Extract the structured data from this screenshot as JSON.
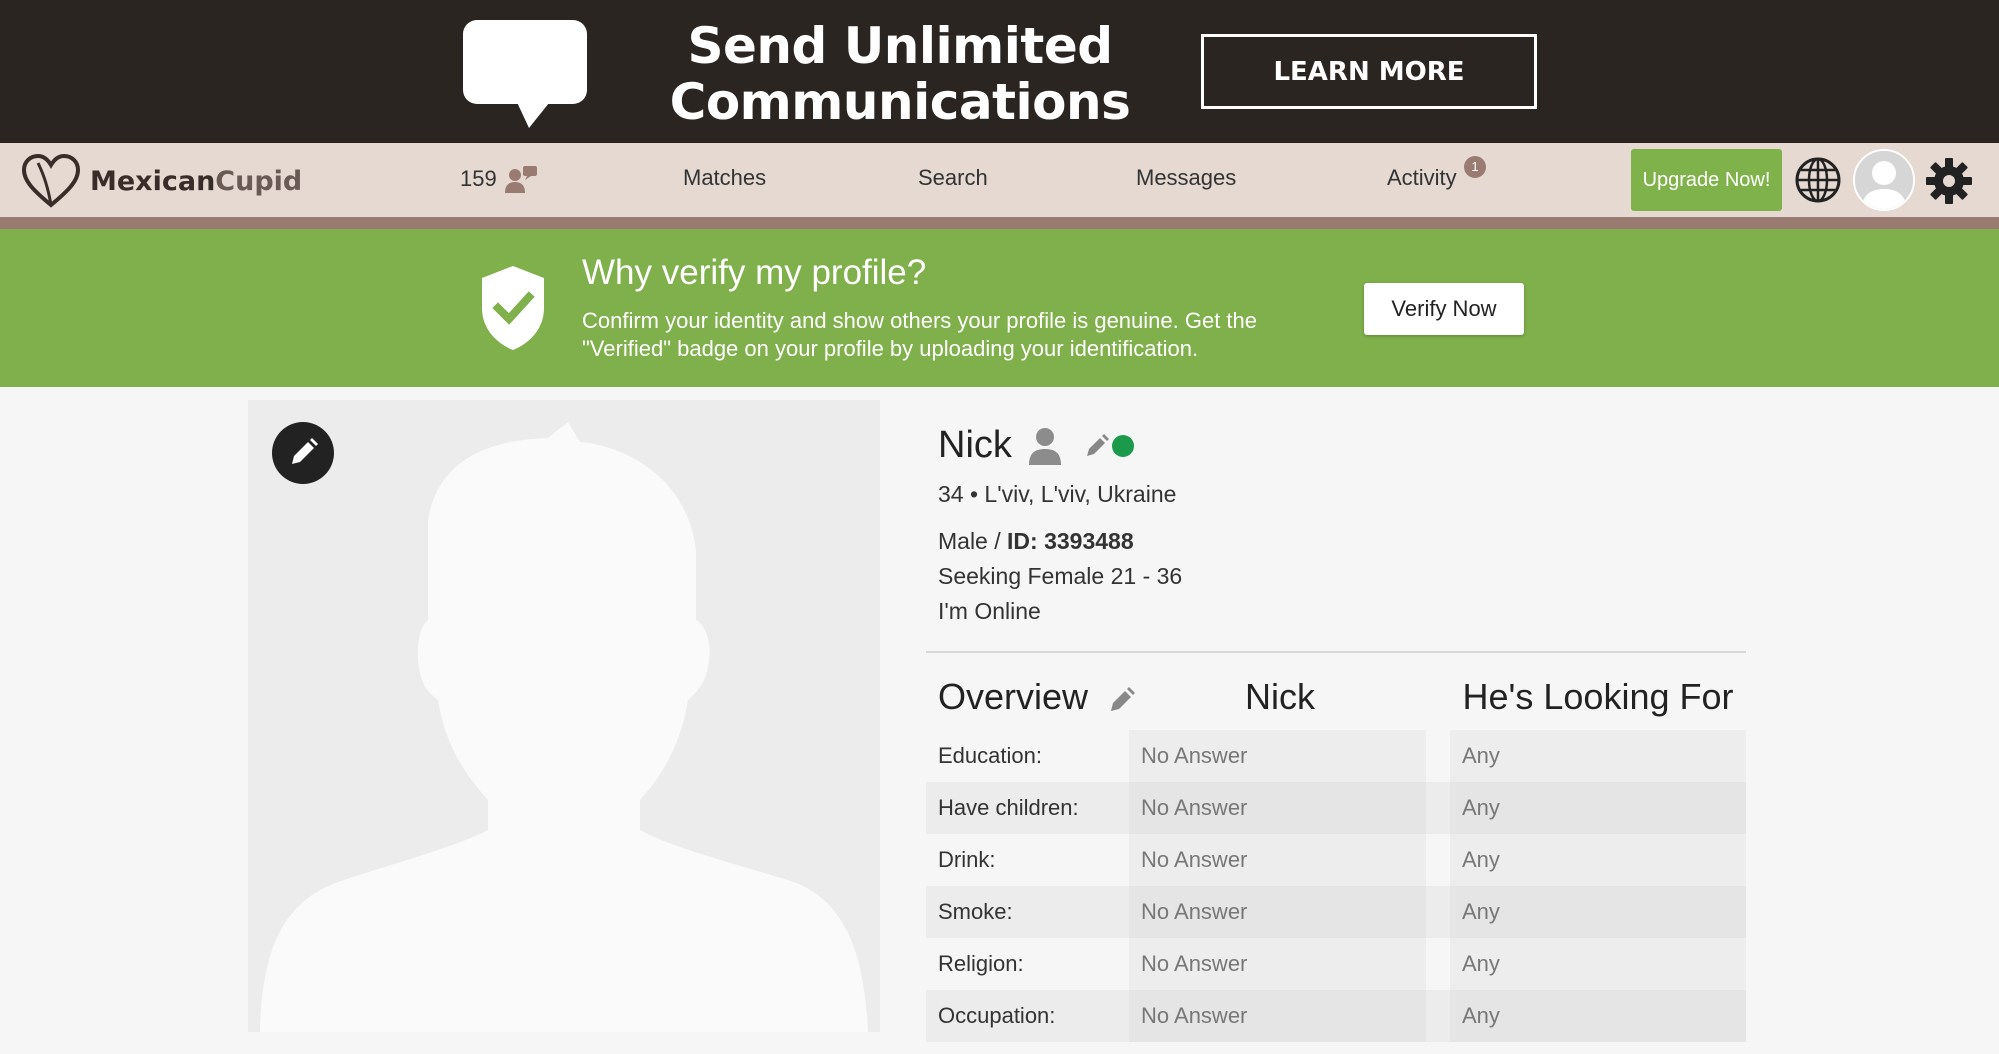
{
  "ad": {
    "headline_line1": "Send Unlimited",
    "headline_line2": "Communications",
    "cta": "LEARN MORE"
  },
  "nav": {
    "logo_text_bold": "Mexican",
    "logo_text_rest": "Cupid",
    "counter": "159",
    "links": [
      "Matches",
      "Search",
      "Messages",
      "Activity"
    ],
    "activity_badge": "1",
    "upgrade": "Upgrade Now!"
  },
  "verify": {
    "title": "Why verify my profile?",
    "text": "Confirm your identity and show others your profile is genuine. Get the \"Verified\" badge on your profile by uploading your identification.",
    "button": "Verify Now"
  },
  "profile": {
    "name": "Nick",
    "age_location": "34 • L'viv, L'viv, Ukraine",
    "gender": "Male / ",
    "id_label": "ID: 3393488",
    "seeking": "Seeking Female 21 - 36",
    "status": "I'm Online",
    "online_color": "#1a9a4a"
  },
  "overview": {
    "title": "Overview",
    "col1": "Nick",
    "col2": "He's Looking For",
    "rows": [
      {
        "label": "Education:",
        "a": "No Answer",
        "b": "Any"
      },
      {
        "label": "Have children:",
        "a": "No Answer",
        "b": "Any"
      },
      {
        "label": "Drink:",
        "a": "No Answer",
        "b": "Any"
      },
      {
        "label": "Smoke:",
        "a": "No Answer",
        "b": "Any"
      },
      {
        "label": "Religion:",
        "a": "No Answer",
        "b": "Any"
      },
      {
        "label": "Occupation:",
        "a": "No Answer",
        "b": "Any"
      }
    ]
  },
  "colors": {
    "ad_bg": "#2b2522",
    "nav_bg": "#e5d9d2",
    "brand_green": "#7fb04b",
    "upgrade_green": "#7fb24a"
  },
  "icons": {
    "speech_bubble": "speech-bubble-icon",
    "logo_heart": "heart-logo-icon",
    "members": "members-icon",
    "globe": "globe-icon",
    "avatar": "avatar",
    "settings": "gear-icon",
    "shield": "shield-check-icon",
    "edit": "pencil-icon",
    "person": "person-icon"
  }
}
